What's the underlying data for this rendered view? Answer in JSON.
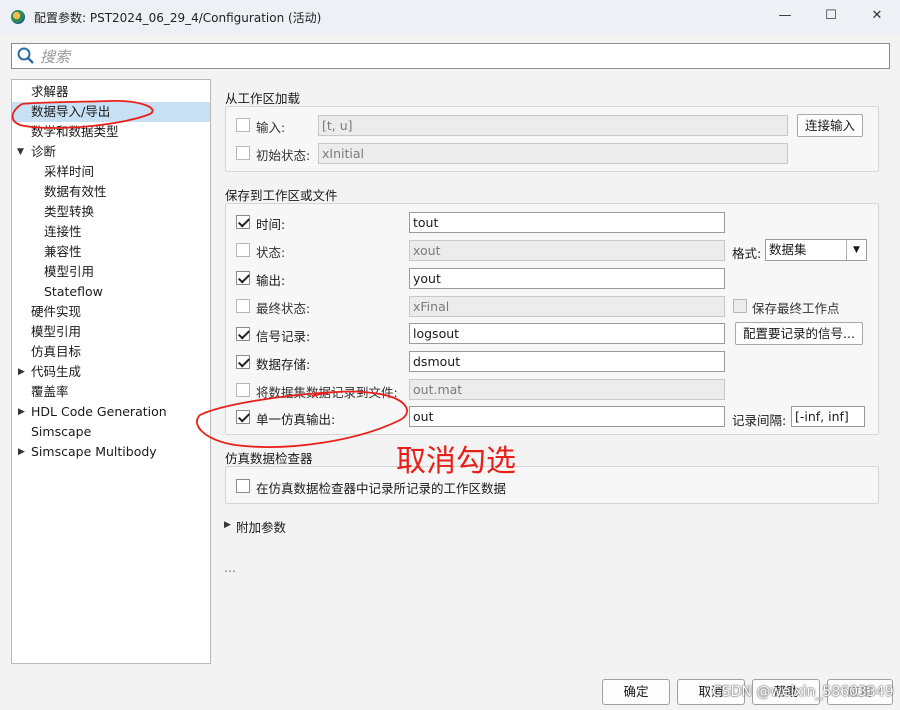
{
  "window": {
    "title": "配置参数: PST2024_06_29_4/Configuration (活动)",
    "minimize": "—",
    "maximize": "☐",
    "close": "✕"
  },
  "search": {
    "placeholder": "搜索"
  },
  "tree": {
    "items": [
      {
        "label": "求解器"
      },
      {
        "label": "数据导入/导出"
      },
      {
        "label": "数学和数据类型"
      },
      {
        "label": "诊断"
      },
      {
        "label": "采样时间"
      },
      {
        "label": "数据有效性"
      },
      {
        "label": "类型转换"
      },
      {
        "label": "连接性"
      },
      {
        "label": "兼容性"
      },
      {
        "label": "模型引用"
      },
      {
        "label": "Stateflow"
      },
      {
        "label": "硬件实现"
      },
      {
        "label": "模型引用"
      },
      {
        "label": "仿真目标"
      },
      {
        "label": "代码生成"
      },
      {
        "label": "覆盖率"
      },
      {
        "label": "HDL Code Generation"
      },
      {
        "label": "Simscape"
      },
      {
        "label": "Simscape Multibody"
      }
    ]
  },
  "load": {
    "title": "从工作区加载",
    "input_label": "输入:",
    "input_value": "[t, u]",
    "connect_button": "连接输入",
    "initial_label": "初始状态:",
    "initial_value": "xInitial"
  },
  "save": {
    "title": "保存到工作区或文件",
    "time_label": "时间:",
    "time_value": "tout",
    "states_label": "状态:",
    "states_value": "xout",
    "format_label": "格式:",
    "format_value": "数据集",
    "output_label": "输出:",
    "output_value": "yout",
    "final_label": "最终状态:",
    "final_value": "xFinal",
    "save_final_point": "保存最终工作点",
    "signal_label": "信号记录:",
    "signal_value": "logsout",
    "config_signals_button": "配置要记录的信号...",
    "datastore_label": "数据存储:",
    "datastore_value": "dsmout",
    "log_to_file_label": "将数据集数据记录到文件:",
    "log_to_file_value": "out.mat",
    "single_output_label": "单一仿真输出:",
    "single_output_value": "out",
    "interval_label": "记录间隔:",
    "interval_value": "[-inf, inf]"
  },
  "inspector": {
    "title": "仿真数据检查器",
    "record_label": "在仿真数据检查器中记录所记录的工作区数据"
  },
  "additional": {
    "label": "附加参数",
    "ellipsis": "..."
  },
  "footer": {
    "ok": "确定",
    "cancel": "取消",
    "help": "帮助",
    "apply": "应用"
  },
  "annotation": {
    "text": "取消勾选",
    "color": "#e8201a"
  },
  "watermark": "CSDN @weixin_58603349",
  "colors": {
    "selection": "#c7e0f4",
    "annotation": "#e8201a"
  }
}
